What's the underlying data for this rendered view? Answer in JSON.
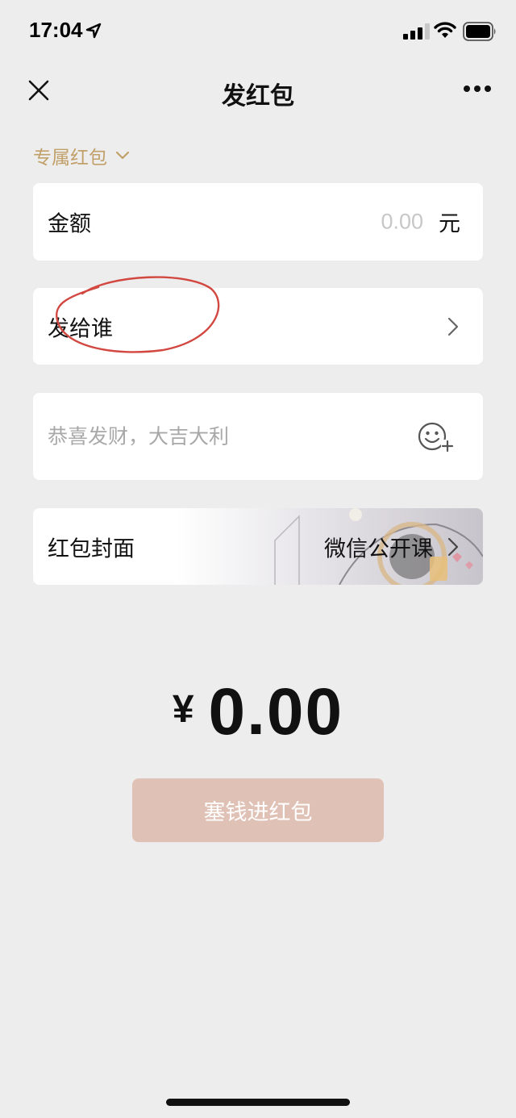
{
  "status_bar": {
    "time": "17:04"
  },
  "nav": {
    "title": "发红包"
  },
  "type_selector": {
    "label": "专属红包"
  },
  "amount": {
    "label": "金额",
    "placeholder": "0.00",
    "unit": "元"
  },
  "recipient": {
    "label": "发给谁"
  },
  "greeting": {
    "placeholder": "恭喜发财，大吉大利"
  },
  "cover": {
    "label": "红包封面",
    "name": "微信公开课"
  },
  "total": {
    "currency": "¥",
    "amount": "0.00"
  },
  "submit": {
    "label": "塞钱进红包"
  },
  "colors": {
    "accent_gold": "#c2a06a",
    "button_disabled": "#e0c1b6",
    "annotation_red": "#d2473f",
    "background": "#ededed"
  }
}
